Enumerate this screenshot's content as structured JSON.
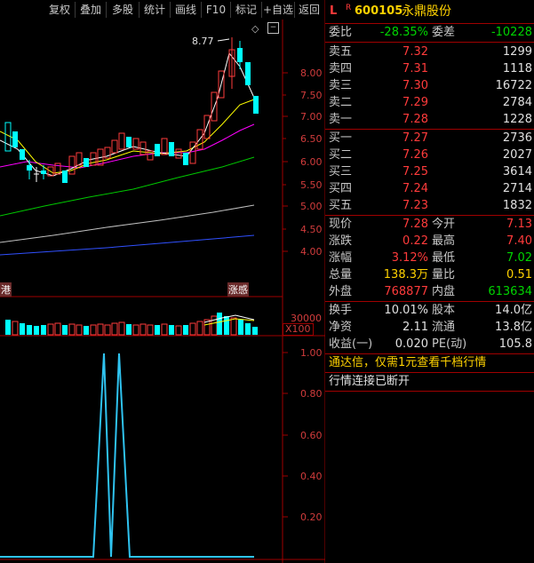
{
  "toolbar": {
    "buttons": [
      "复权",
      "叠加",
      "多股",
      "统计",
      "画线",
      "F10",
      "标记",
      "+自选",
      "返回"
    ]
  },
  "chart": {
    "high_label": "8.77",
    "price_axis": [
      "8.00",
      "7.50",
      "7.00",
      "6.50",
      "6.00",
      "5.50",
      "5.00",
      "4.50",
      "4.00"
    ],
    "event_left": "港",
    "event_right": "涨感",
    "volume_axis": "30000",
    "volume_unit": "X100",
    "indicator_axis": [
      "1.00",
      "0.80",
      "0.60",
      "0.40",
      "0.20"
    ],
    "colors": {
      "up": "#ff3b3b",
      "down": "#00ffff",
      "ma5": "#ffffff",
      "ma10": "#ffff00",
      "ma20": "#ff00ff",
      "ma60": "#00ff00",
      "ma120": "#c0c0c0",
      "ma250": "#3050ff",
      "indicator": "#2fc3f0"
    }
  },
  "chart_data": {
    "type": "line",
    "title": "",
    "series": [
      {
        "values": [
          0,
          0,
          0,
          0,
          0,
          0,
          0,
          1,
          0,
          1,
          0,
          0,
          0,
          0,
          0,
          0,
          0,
          0
        ]
      }
    ],
    "ylim": [
      0,
      1.1
    ]
  },
  "quote": {
    "flag_l": "L",
    "flag_r": "R",
    "code": "600105",
    "name": "永鼎股份",
    "weibi_label": "委比",
    "weibi_value": "-28.35%",
    "weicha_label": "委差",
    "weicha_value": "-10228",
    "sell": [
      {
        "label": "卖五",
        "price": "7.32",
        "vol": "1299"
      },
      {
        "label": "卖四",
        "price": "7.31",
        "vol": "1118"
      },
      {
        "label": "卖三",
        "price": "7.30",
        "vol": "16722"
      },
      {
        "label": "卖二",
        "price": "7.29",
        "vol": "2784"
      },
      {
        "label": "卖一",
        "price": "7.28",
        "vol": "1228"
      }
    ],
    "buy": [
      {
        "label": "买一",
        "price": "7.27",
        "vol": "2736"
      },
      {
        "label": "买二",
        "price": "7.26",
        "vol": "2027"
      },
      {
        "label": "买三",
        "price": "7.25",
        "vol": "3614"
      },
      {
        "label": "买四",
        "price": "7.24",
        "vol": "2714"
      },
      {
        "label": "买五",
        "price": "7.23",
        "vol": "1832"
      }
    ],
    "stats": [
      {
        "l1": "现价",
        "v1": "7.28",
        "l2": "今开",
        "v2": "7.13"
      },
      {
        "l1": "涨跌",
        "v1": "0.22",
        "l2": "最高",
        "v2": "7.40"
      },
      {
        "l1": "涨幅",
        "v1": "3.12%",
        "l2": "最低",
        "v2": "7.02"
      },
      {
        "l1": "总量",
        "v1": "138.3万",
        "l2": "量比",
        "v2": "0.51"
      },
      {
        "l1": "外盘",
        "v1": "768877",
        "l2": "内盘",
        "v2": "613634"
      }
    ],
    "fund": [
      {
        "l1": "换手",
        "v1": "10.01%",
        "l2": "股本",
        "v2": "14.0亿"
      },
      {
        "l1": "净资",
        "v1": "2.11",
        "l2": "流通",
        "v2": "13.8亿"
      },
      {
        "l1": "收益(一)",
        "v1": "0.020",
        "l2": "PE(动)",
        "v2": "105.8"
      }
    ],
    "promo": "通达信，仅需1元查看千档行情",
    "status": "行情连接已断开"
  }
}
